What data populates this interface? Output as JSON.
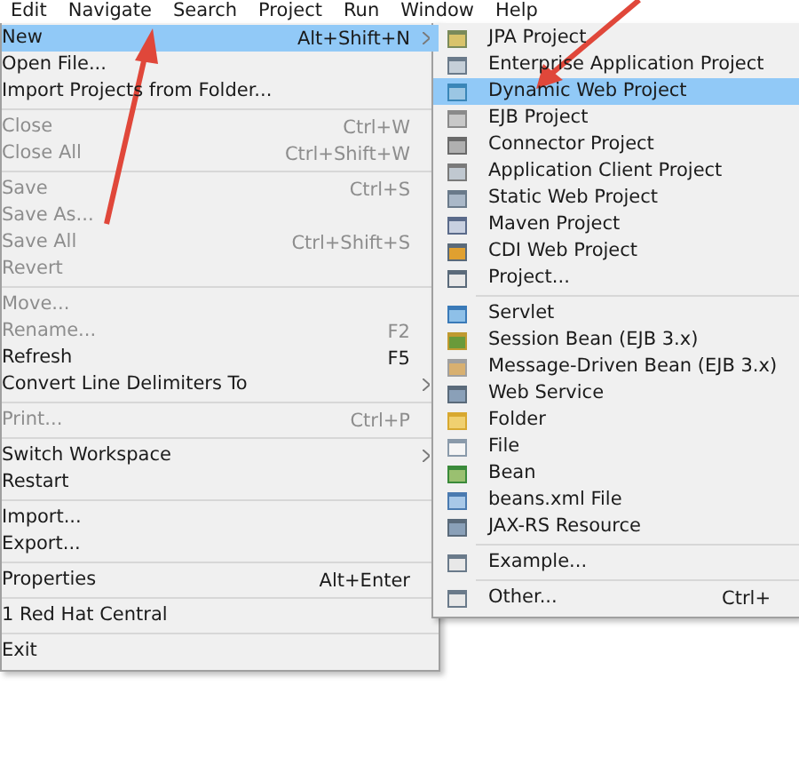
{
  "menubar": [
    {
      "label": "Edit"
    },
    {
      "label": "Navigate"
    },
    {
      "label": "Search"
    },
    {
      "label": "Project"
    },
    {
      "label": "Run"
    },
    {
      "label": "Window"
    },
    {
      "label": "Help"
    }
  ],
  "file_menu": [
    {
      "kind": "item",
      "label": "New",
      "shortcut": "Alt+Shift+N",
      "submenu": true,
      "disabled": false,
      "selected": true
    },
    {
      "kind": "item",
      "label": "Open File...",
      "submenu": false,
      "disabled": false,
      "selected": false
    },
    {
      "kind": "item",
      "label": "Import Projects from Folder...",
      "submenu": false,
      "disabled": false,
      "selected": false
    },
    {
      "kind": "separator"
    },
    {
      "kind": "item",
      "label": "Close",
      "shortcut": "Ctrl+W",
      "submenu": false,
      "disabled": true,
      "selected": false
    },
    {
      "kind": "item",
      "label": "Close All",
      "shortcut": "Ctrl+Shift+W",
      "submenu": false,
      "disabled": true,
      "selected": false
    },
    {
      "kind": "separator"
    },
    {
      "kind": "item",
      "label": "Save",
      "shortcut": "Ctrl+S",
      "submenu": false,
      "disabled": true,
      "selected": false
    },
    {
      "kind": "item",
      "label": "Save As...",
      "submenu": false,
      "disabled": true,
      "selected": false
    },
    {
      "kind": "item",
      "label": "Save All",
      "shortcut": "Ctrl+Shift+S",
      "submenu": false,
      "disabled": true,
      "selected": false
    },
    {
      "kind": "item",
      "label": "Revert",
      "submenu": false,
      "disabled": true,
      "selected": false
    },
    {
      "kind": "separator"
    },
    {
      "kind": "item",
      "label": "Move...",
      "submenu": false,
      "disabled": true,
      "selected": false
    },
    {
      "kind": "item",
      "label": "Rename...",
      "shortcut": "F2",
      "submenu": false,
      "disabled": true,
      "selected": false
    },
    {
      "kind": "item",
      "label": "Refresh",
      "shortcut": "F5",
      "submenu": false,
      "disabled": false,
      "selected": false
    },
    {
      "kind": "item",
      "label": "Convert Line Delimiters To",
      "submenu": true,
      "disabled": false,
      "selected": false
    },
    {
      "kind": "separator"
    },
    {
      "kind": "item",
      "label": "Print...",
      "shortcut": "Ctrl+P",
      "submenu": false,
      "disabled": true,
      "selected": false
    },
    {
      "kind": "separator"
    },
    {
      "kind": "item",
      "label": "Switch Workspace",
      "submenu": true,
      "disabled": false,
      "selected": false
    },
    {
      "kind": "item",
      "label": "Restart",
      "submenu": false,
      "disabled": false,
      "selected": false
    },
    {
      "kind": "separator"
    },
    {
      "kind": "item",
      "label": "Import...",
      "submenu": false,
      "disabled": false,
      "selected": false
    },
    {
      "kind": "item",
      "label": "Export...",
      "submenu": false,
      "disabled": false,
      "selected": false
    },
    {
      "kind": "separator"
    },
    {
      "kind": "item",
      "label": "Properties",
      "shortcut": "Alt+Enter",
      "submenu": false,
      "disabled": false,
      "selected": false
    },
    {
      "kind": "separator"
    },
    {
      "kind": "item",
      "label": "1 Red Hat Central",
      "submenu": false,
      "disabled": false,
      "selected": false
    },
    {
      "kind": "separator"
    },
    {
      "kind": "item",
      "label": "Exit",
      "submenu": false,
      "disabled": false,
      "selected": false
    }
  ],
  "new_submenu": [
    {
      "kind": "item",
      "label": "JPA Project",
      "selected": false
    },
    {
      "kind": "item",
      "label": "Enterprise Application Project",
      "selected": false
    },
    {
      "kind": "item",
      "label": "Dynamic Web Project",
      "selected": true
    },
    {
      "kind": "item",
      "label": "EJB Project",
      "selected": false
    },
    {
      "kind": "item",
      "label": "Connector Project",
      "selected": false
    },
    {
      "kind": "item",
      "label": "Application Client Project",
      "selected": false
    },
    {
      "kind": "item",
      "label": "Static Web Project",
      "selected": false
    },
    {
      "kind": "item",
      "label": "Maven Project",
      "selected": false
    },
    {
      "kind": "item",
      "label": "CDI Web Project",
      "selected": false
    },
    {
      "kind": "item",
      "label": "Project...",
      "selected": false
    },
    {
      "kind": "separator"
    },
    {
      "kind": "item",
      "label": "Servlet",
      "selected": false
    },
    {
      "kind": "item",
      "label": "Session Bean (EJB 3.x)",
      "selected": false
    },
    {
      "kind": "item",
      "label": "Message-Driven Bean (EJB 3.x)",
      "selected": false
    },
    {
      "kind": "item",
      "label": "Web Service",
      "selected": false
    },
    {
      "kind": "item",
      "label": "Folder",
      "selected": false
    },
    {
      "kind": "item",
      "label": "File",
      "selected": false
    },
    {
      "kind": "item",
      "label": "Bean",
      "selected": false
    },
    {
      "kind": "item",
      "label": "beans.xml File",
      "selected": false
    },
    {
      "kind": "item",
      "label": "JAX-RS Resource",
      "selected": false
    },
    {
      "kind": "separator"
    },
    {
      "kind": "item",
      "label": "Example...",
      "selected": false
    },
    {
      "kind": "separator"
    },
    {
      "kind": "item",
      "label": "Other...",
      "shortcut": "Ctrl+",
      "selected": false
    }
  ]
}
